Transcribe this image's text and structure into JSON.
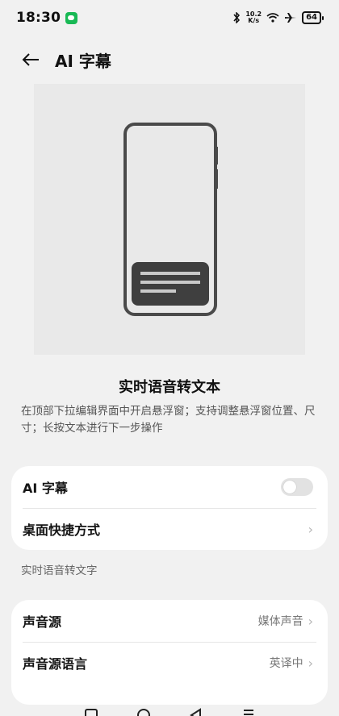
{
  "status_bar": {
    "time": "18:30",
    "net_speed_value": "10.2",
    "net_speed_unit": "K/s",
    "battery": "64"
  },
  "header": {
    "title": "AI 字幕"
  },
  "feature": {
    "headline": "实时语音转文本",
    "description": "在顶部下拉编辑界面中开启悬浮窗；支持调整悬浮窗位置、尺寸；长按文本进行下一步操作"
  },
  "settings_card": {
    "ai_caption_label": "AI 字幕",
    "ai_caption_enabled": false,
    "shortcut_label": "桌面快捷方式"
  },
  "section_label": "实时语音转文字",
  "source_card": {
    "sound_source_label": "声音源",
    "sound_source_value": "媒体声音",
    "source_language_label": "声音源语言",
    "source_language_value": "英译中"
  },
  "colors": {
    "background": "#f1f1f1",
    "card": "#ffffff",
    "wechat_green": "#19b955",
    "illustration_bg": "#e9e9e9",
    "phone_outline": "#4a4a4a"
  },
  "icons": {
    "back": "back-arrow-icon",
    "chevron": "chevron-right-icon",
    "nav_recents": "square-icon",
    "nav_home": "circle-icon",
    "nav_back": "triangle-icon",
    "nav_menu": "menu-icon"
  }
}
